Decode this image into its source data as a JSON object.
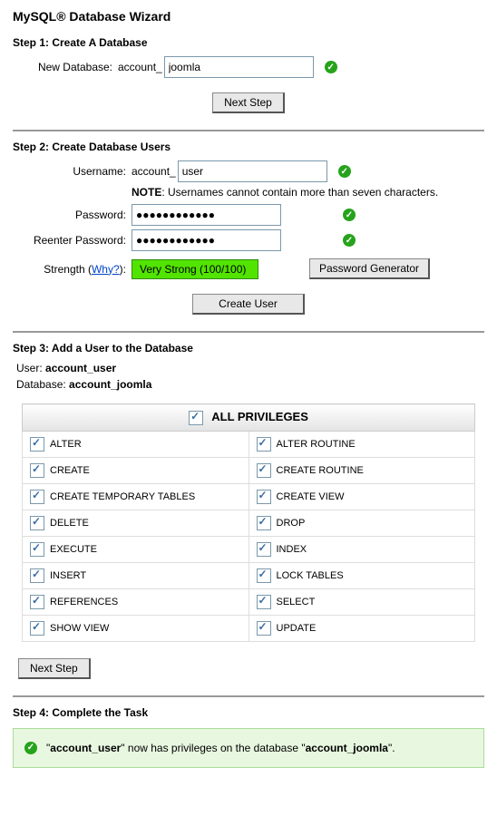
{
  "title": "MySQL® Database Wizard",
  "step1": {
    "heading": "Step 1: Create A Database",
    "label": "New Database:",
    "prefix": "account_",
    "value": "joomla",
    "next": "Next Step"
  },
  "step2": {
    "heading": "Step 2: Create Database Users",
    "username_label": "Username:",
    "username_prefix": "account_",
    "username_value": "user",
    "note_bold": "NOTE",
    "note_text": ": Usernames cannot contain more than seven characters.",
    "password_label": "Password:",
    "password_value": "●●●●●●●●●●●●",
    "repassword_label": "Reenter Password:",
    "repassword_value": "●●●●●●●●●●●●",
    "strength_label_pre": "Strength (",
    "strength_why": "Why?",
    "strength_label_post": "):",
    "strength_text": "Very Strong (100/100)",
    "pw_gen_btn": "Password Generator",
    "create_btn": "Create User"
  },
  "step3": {
    "heading": "Step 3: Add a User to the Database",
    "user_label": "User: ",
    "user_value": "account_user",
    "db_label": "Database: ",
    "db_value": "account_joomla",
    "all_label": "ALL PRIVILEGES",
    "privs": [
      [
        "ALTER",
        "ALTER ROUTINE"
      ],
      [
        "CREATE",
        "CREATE ROUTINE"
      ],
      [
        "CREATE TEMPORARY TABLES",
        "CREATE VIEW"
      ],
      [
        "DELETE",
        "DROP"
      ],
      [
        "EXECUTE",
        "INDEX"
      ],
      [
        "INSERT",
        "LOCK TABLES"
      ],
      [
        "REFERENCES",
        "SELECT"
      ],
      [
        "SHOW VIEW",
        "UPDATE"
      ]
    ],
    "next": "Next Step"
  },
  "step4": {
    "heading": "Step 4: Complete the Task",
    "msg_q1": "\"",
    "msg_user": "account_user",
    "msg_mid": "\" now has privileges on the database \"",
    "msg_db": "account_joomla",
    "msg_end": "\"."
  }
}
